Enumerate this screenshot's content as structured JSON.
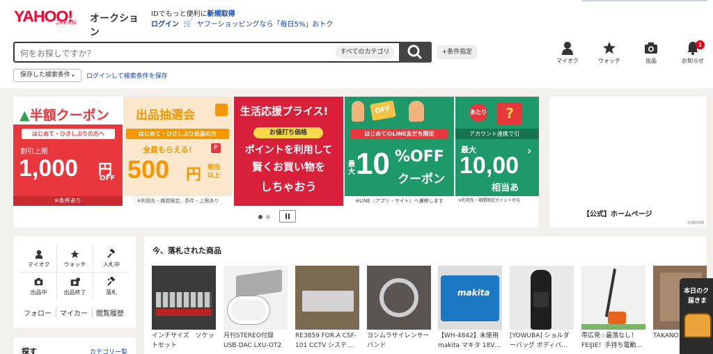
{
  "header": {
    "logo_main": "YAHOO!",
    "logo_sub": "JAPAN",
    "logo_service": "オークション",
    "promo_prefix": "IDでもっと便利に",
    "promo_link": "新規取得",
    "login": "ログイン",
    "shopping_promo": "ヤフーショッピングなら「毎日5%」おトク",
    "search_placeholder": "何をお探しですか？",
    "search_category": "すべてのカテゴリ",
    "condition_button": "+条件指定",
    "saved_search": "保存した検索条件",
    "login_save": "ログインして検索条件を保存",
    "icons": [
      {
        "label": "マイオク",
        "icon": "person-icon"
      },
      {
        "label": "ウォッチ",
        "icon": "star-icon"
      },
      {
        "label": "出品",
        "icon": "camera-icon"
      },
      {
        "label": "お知らせ",
        "icon": "bell-icon",
        "badge": "1"
      }
    ]
  },
  "banners": [
    {
      "title": "半額クーポン",
      "band": "はじめて・ひさしぶりの方へ",
      "small": "割引上限",
      "amount": "1,000",
      "unit": "円",
      "extra": "OFF",
      "foot": "※条件あり",
      "bg": "#e8383d"
    },
    {
      "title": "出品抽選会",
      "band": "はじめて・ひさしぶり出品の方",
      "small": "全員もらえる！",
      "amount": "500",
      "unit": "円",
      "extra": "相当以上",
      "foot": "※利用先・期間限定。条件・上限あり",
      "bg": "#fbe7cc"
    },
    {
      "title": "生活応援プライス!",
      "band": "お値打ち価格",
      "line1": "ポイントを利用して",
      "line2": "賢くお買い物を",
      "line3": "しちゃおう",
      "bg": "#d8203a"
    },
    {
      "badge": "OFF",
      "band": "はじめてのLINE友だち限定",
      "small": "最大",
      "amount": "10",
      "unit": "%OFF",
      "extra": "クーポン",
      "foot": "※LINE（アプリ・サイト）へ遷移します",
      "bg": "#1e9a6a"
    },
    {
      "badge": "あたり",
      "band": "アカウント連携で引",
      "small": "最大",
      "amount": "10,00",
      "extra": "相当あ",
      "foot": "※利用先・期間限定ポイント付与",
      "bg": "#1e9a6a"
    }
  ],
  "ad": {
    "title": "【公式】ホームページ",
    "source": "indeed"
  },
  "side_menu": {
    "items": [
      {
        "label": "マイオク",
        "icon": "person-icon"
      },
      {
        "label": "ウォッチ",
        "icon": "star-icon"
      },
      {
        "label": "入札中",
        "icon": "gavel-icon"
      },
      {
        "label": "出品中",
        "icon": "camera-icon"
      },
      {
        "label": "出品終了",
        "icon": "camera-check-icon"
      },
      {
        "label": "落札",
        "icon": "gavel-won-icon"
      }
    ],
    "links": [
      "フォロー",
      "マイカー",
      "閲覧履歴"
    ],
    "search_title": "探す",
    "category_link": "カテゴリ一覧"
  },
  "sold": {
    "heading": "今、落札された商品",
    "products": [
      {
        "title": "インチサイズ　ソケットセット",
        "price": ""
      },
      {
        "title": "月刊STEREO付録 USB-DAC LXU-OT2（…",
        "price": ""
      },
      {
        "title": "RE3859 FOR.A CSF-101 CCTV システ…",
        "price": ""
      },
      {
        "title": "ヨシムラサイレンサーバンド",
        "price": ""
      },
      {
        "title": "【WH-4842】未使用 makita マキタ 18V…",
        "price": ""
      },
      {
        "title": "[YOWUBA] ショルダーバッグ ボディバ…",
        "price": ""
      },
      {
        "title": "帯広発☆最落なし！FEIJIE！手持ち電動…",
        "price": ""
      },
      {
        "title": "TAKANO rCell Bio",
        "price": ""
      }
    ]
  },
  "float_promo": {
    "line1": "本日のク",
    "line2": "届きま"
  },
  "carousel": {
    "pause": "pause"
  }
}
